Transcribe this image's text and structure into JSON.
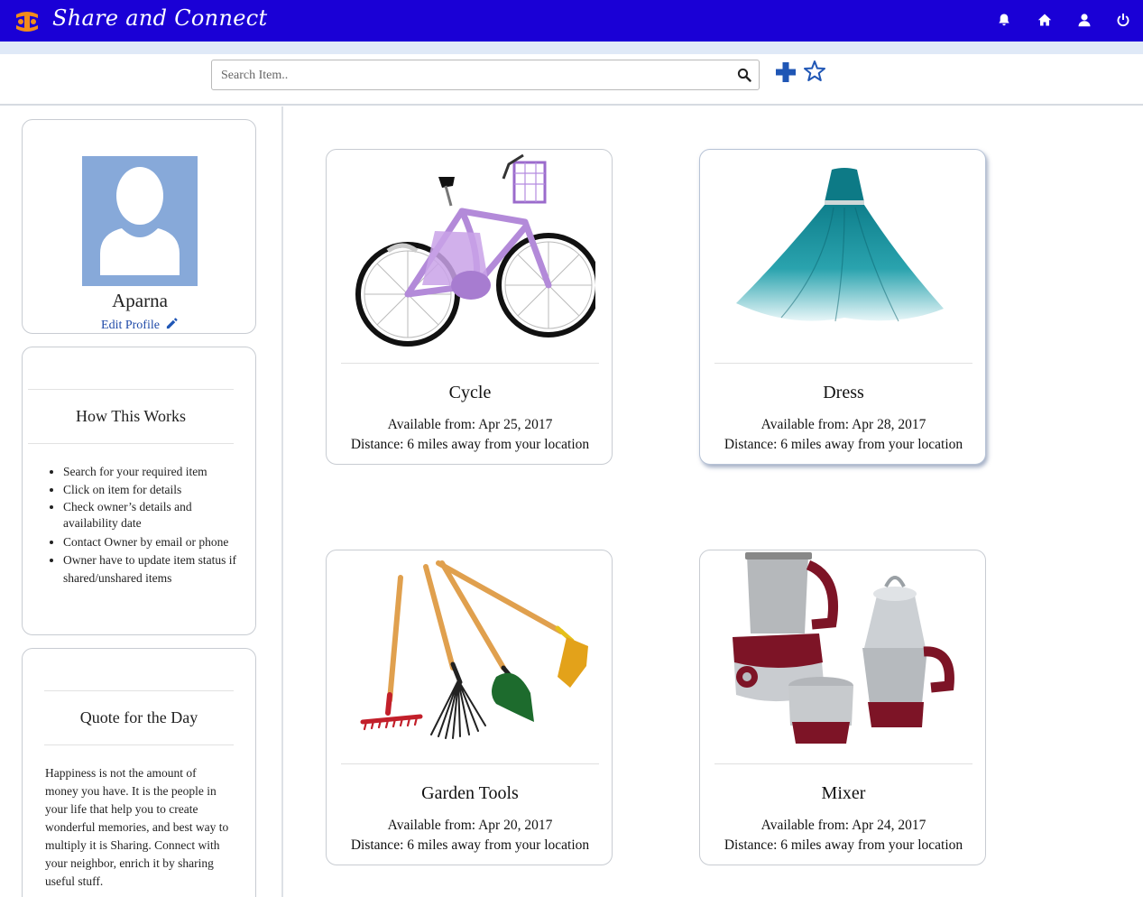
{
  "app": {
    "brand": "Share and Connect",
    "brand_color": "#1a00d6",
    "icons": [
      "bell-icon",
      "home-icon",
      "user-icon",
      "power-icon"
    ]
  },
  "search": {
    "placeholder": "Search Item..",
    "value": ""
  },
  "profile": {
    "name": "Aparna",
    "edit_label": "Edit Profile"
  },
  "how_it_works": {
    "title": "How This Works",
    "steps": [
      "Search for your required item",
      "Click on item for details",
      "Check owner’s details and availability date",
      "Contact Owner by email or phone",
      "Owner have to update item status if shared/unshared items"
    ]
  },
  "quote": {
    "title": "Quote for the Day",
    "text": "Happiness is not the amount of money you have. It is the people in your life that help you to create wonderful memories, and best way to multiply it is Sharing. Connect with your neighbor, enrich it by sharing useful stuff."
  },
  "items": [
    {
      "title": "Cycle",
      "available": "Available from: Apr 25, 2017",
      "distance": "Distance: 6 miles away from your location"
    },
    {
      "title": "Dress",
      "available": "Available from: Apr 28, 2017",
      "distance": "Distance: 6 miles away from your location"
    },
    {
      "title": "Garden Tools",
      "available": "Available from: Apr 20, 2017",
      "distance": "Distance: 6 miles away from your location"
    },
    {
      "title": "Mixer",
      "available": "Available from: Apr 24, 2017",
      "distance": "Distance: 6 miles away from your location"
    }
  ]
}
